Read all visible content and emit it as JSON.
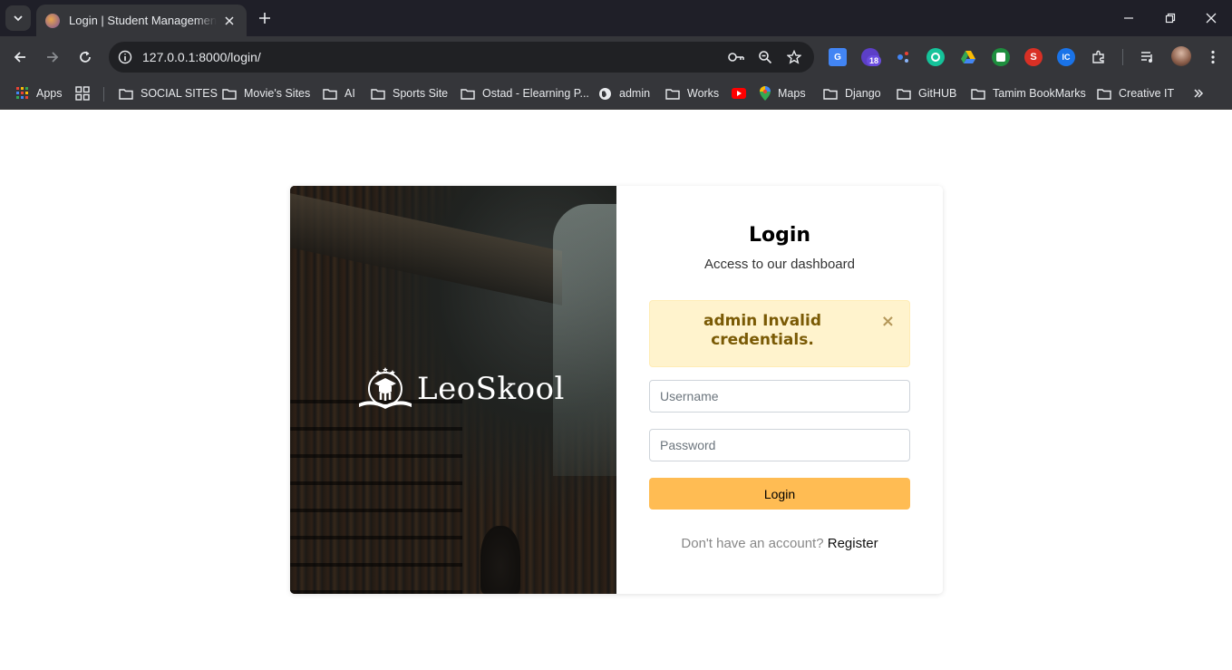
{
  "browser": {
    "tab_title": "Login | Student Management System",
    "url": "127.0.0.1:8000/login/",
    "extension_badge": "18",
    "bookmarks": [
      {
        "label": "Apps",
        "icon": "apps-grid-icon"
      },
      {
        "label": "",
        "icon": "tab-groups-icon"
      },
      {
        "label": "SOCIAL SITES",
        "icon": "folder-icon"
      },
      {
        "label": "Movie's Sites",
        "icon": "folder-icon"
      },
      {
        "label": "AI",
        "icon": "folder-icon"
      },
      {
        "label": "Sports Site",
        "icon": "folder-icon"
      },
      {
        "label": "Ostad - Elearning P...",
        "icon": "folder-icon"
      },
      {
        "label": "admin",
        "icon": "globe-icon"
      },
      {
        "label": "Works",
        "icon": "folder-icon"
      },
      {
        "label": "",
        "icon": "youtube-icon"
      },
      {
        "label": "Maps",
        "icon": "maps-icon"
      },
      {
        "label": "Django",
        "icon": "folder-icon"
      },
      {
        "label": "GitHUB",
        "icon": "folder-icon"
      },
      {
        "label": "Tamim BookMarks",
        "icon": "folder-icon"
      },
      {
        "label": "Creative IT",
        "icon": "folder-icon"
      }
    ]
  },
  "brand": {
    "name": "LeoSkool"
  },
  "login": {
    "title": "Login",
    "subtitle": "Access to our dashboard",
    "alert_message": "admin Invalid credentials.",
    "alert_close": "×",
    "username_placeholder": "Username",
    "password_placeholder": "Password",
    "submit_label": "Login",
    "register_prompt": "Don't have an account?",
    "register_link": "Register"
  },
  "colors": {
    "accent": "#ffbc53",
    "alert_bg": "#fff3cd",
    "alert_text": "#7a5a05"
  }
}
